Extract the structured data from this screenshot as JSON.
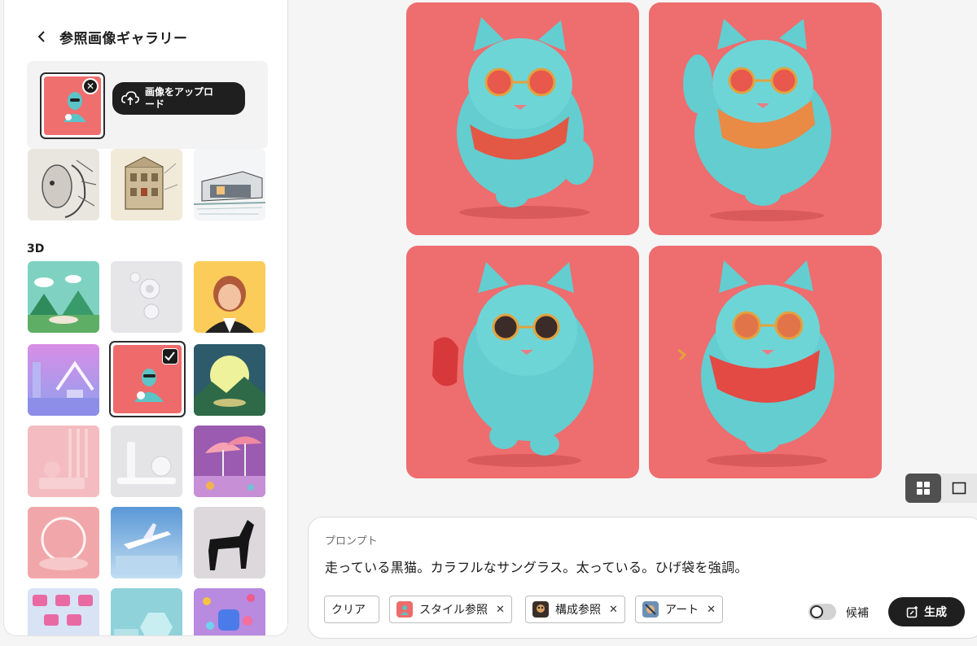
{
  "gallery_panel": {
    "title": "参照画像ギャラリー",
    "upload_label": "画像をアップロード",
    "section_3d": "3D"
  },
  "prompt": {
    "label": "プロンプト",
    "text": "走っている黒猫。カラフルなサングラス。太っている。ひげ袋を強調。",
    "chips": [
      {
        "label": "クリア"
      },
      {
        "label": "スタイル参照"
      },
      {
        "label": "構成参照"
      },
      {
        "label": "アート"
      }
    ],
    "suggest_toggle_label": "候補",
    "generate_label": "生成"
  },
  "colors": {
    "accent_dark": "#1f1f1f",
    "result_bg": "#ee6d6e",
    "cat_color": "#63cdd0"
  }
}
